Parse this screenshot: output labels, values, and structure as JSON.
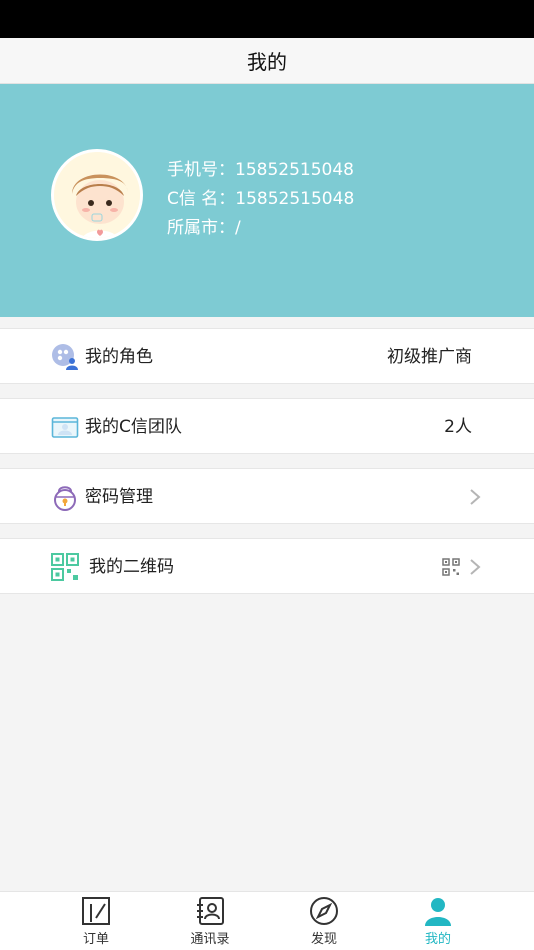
{
  "header": {
    "title": "我的"
  },
  "profile": {
    "phone_label": "手机号：",
    "phone_value": "15852515048",
    "cname_label": "C信 名：",
    "cname_value": "15852515048",
    "city_label": "所属市：",
    "city_value": "/",
    "bg_color": "#7ecbd3"
  },
  "menu": [
    {
      "label": "我的角色",
      "value": "初级推广商",
      "icon": "role-icon"
    },
    {
      "label": "我的C信团队",
      "value": "2人",
      "icon": "team-icon"
    },
    {
      "label": "密码管理",
      "value": "",
      "icon": "lock-icon"
    },
    {
      "label": "我的二维码",
      "value": "",
      "icon": "qr-code-icon"
    }
  ],
  "nav": [
    {
      "label": "订单",
      "icon": "order-icon",
      "active": false
    },
    {
      "label": "通讯录",
      "icon": "contacts-icon",
      "active": false
    },
    {
      "label": "发现",
      "icon": "compass-icon",
      "active": false
    },
    {
      "label": "我的",
      "icon": "person-icon",
      "active": true
    }
  ],
  "colors": {
    "accent": "#22b7c3",
    "status_bar": "#000000"
  }
}
